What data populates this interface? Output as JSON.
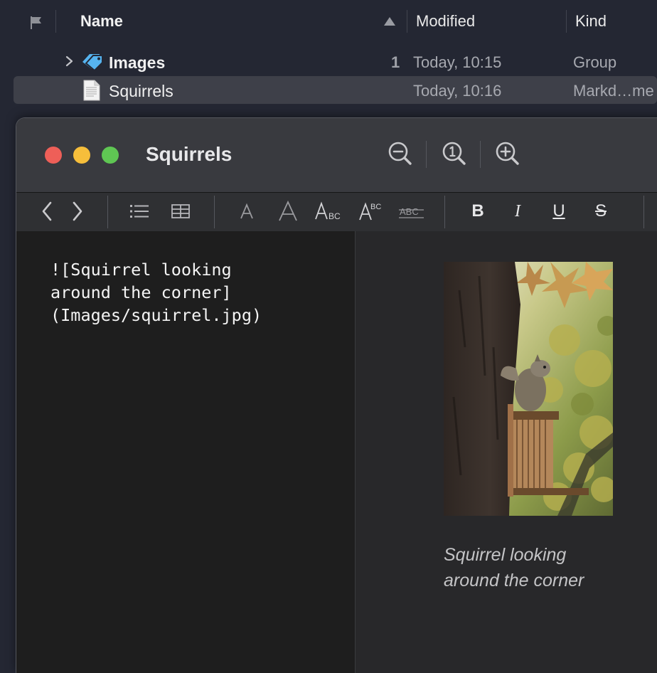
{
  "list": {
    "columns": {
      "name": "Name",
      "modified": "Modified",
      "kind": "Kind"
    },
    "rows": [
      {
        "name": "Images",
        "count": "1",
        "modified": "Today, 10:15",
        "kind": "Group",
        "icon": "tag-icon",
        "expanded": false
      },
      {
        "name": "Squirrels",
        "modified": "Today, 10:16",
        "kind": "Markd…me",
        "icon": "document-icon",
        "selected": true
      }
    ]
  },
  "window": {
    "title": "Squirrels",
    "zoom": [
      "zoom-out-icon",
      "actual-size-icon",
      "zoom-in-icon"
    ]
  },
  "toolbar": {
    "items": [
      "back-icon",
      "forward-icon",
      "list-icon",
      "table-icon",
      "font-smaller-icon",
      "font-larger-icon",
      "small-caps-icon",
      "superscript-icon",
      "strikeout-caps-icon",
      "bold-icon",
      "italic-icon",
      "underline-icon",
      "strikethrough-icon"
    ],
    "bold": "B",
    "italic": "I",
    "underline": "U",
    "strike": "S"
  },
  "editor": {
    "text": "![Squirrel looking\naround the corner]\n(Images/squirrel.jpg)"
  },
  "preview": {
    "image_alt": "Squirrel looking around the corner",
    "caption": "Squirrel looking\naround the corner"
  },
  "colors": {
    "close": "#ee5f58",
    "minimize": "#f6be3b",
    "maximize": "#5fc653",
    "tag_blue": "#56b4f0"
  }
}
